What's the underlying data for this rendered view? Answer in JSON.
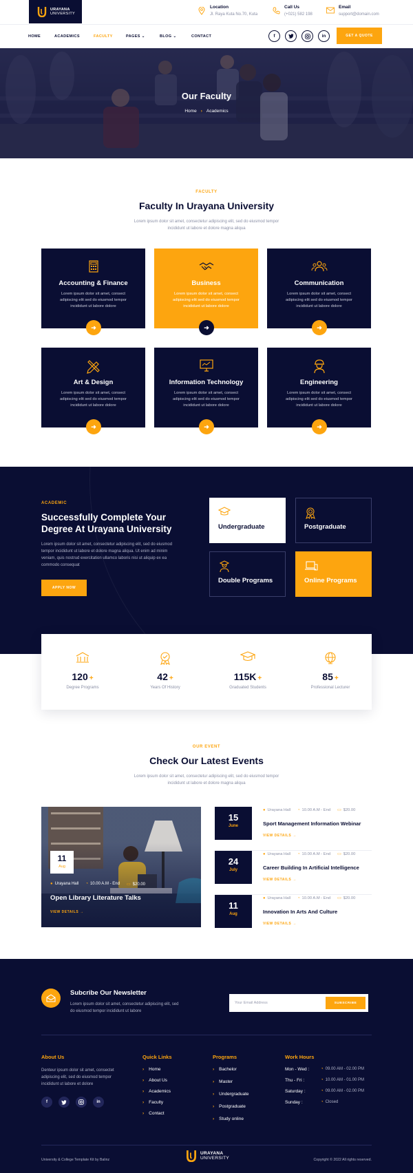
{
  "brand": {
    "name": "URAYANA",
    "subtitle": "UNIVERSITY",
    "accent_color": "#fda50f",
    "navy_color": "#0a0e33"
  },
  "topbar": {
    "location": {
      "label": "Location",
      "value": "Jl. Raya Kuta No.70, Kuta",
      "icon": "map-pin-icon"
    },
    "call": {
      "label": "Call Us",
      "value": "(+021) 582 198",
      "icon": "phone-icon"
    },
    "email": {
      "label": "Email",
      "value": "support@domain.com",
      "icon": "mail-icon"
    }
  },
  "nav": {
    "items": [
      {
        "label": "HOME",
        "active": false
      },
      {
        "label": "ACADEMICS",
        "active": false
      },
      {
        "label": "FACULTY",
        "active": true
      },
      {
        "label": "PAGES",
        "dropdown": true
      },
      {
        "label": "BLOG",
        "dropdown": true
      },
      {
        "label": "CONTACT",
        "active": false
      }
    ],
    "social": [
      "f",
      "t",
      "ig",
      "in"
    ],
    "cta": "GET A QUOTE"
  },
  "hero": {
    "title": "Our Faculty",
    "breadcrumb": [
      "Home",
      "Academics"
    ]
  },
  "faculty": {
    "eyebrow": "FACULTY",
    "title": "Faculty In Urayana University",
    "desc": "Lorem ipsum dolor sit amet, consectetur adipiscing elit, sed do eiusmod tempor incididunt ut labore et dolore magna aliqua",
    "cards": [
      {
        "title": "Accounting & Finance",
        "desc": "Lorem ipsum dolor sit amet, consect adipiscing elit sed do eiusmod tempor incididunt ut labore dolore",
        "icon": "calculator-icon"
      },
      {
        "title": "Business",
        "desc": "Lorem ipsum dolor sit amet, consect adipiscing elit sed do eiusmod tempor incididunt ut labore dolore",
        "icon": "handshake-icon"
      },
      {
        "title": "Communication",
        "desc": "Lorem ipsum dolor sit amet, consect adipiscing elit sed do eiusmod tempor incididunt ut labore dolore",
        "icon": "people-icon"
      },
      {
        "title": "Art & Design",
        "desc": "Lorem ipsum dolor sit amet, consect adipiscing elit sed do eiusmod tempor incididunt ut labore dolore",
        "icon": "pencil-ruler-icon"
      },
      {
        "title": "Information Technology",
        "desc": "Lorem ipsum dolor sit amet, consect adipiscing elit sed do eiusmod tempor incididunt ut labore dolore",
        "icon": "monitor-icon"
      },
      {
        "title": "Engineering",
        "desc": "Lorem ipsum dolor sit amet, consect adipiscing elit sed do eiusmod tempor incididunt ut labore dolore",
        "icon": "engineer-icon"
      }
    ]
  },
  "academic": {
    "eyebrow": "ACADEMIC",
    "title": "Successfully Complete Your Degree At Urayana University",
    "desc": "Lorem ipsum dolor sit amet, consectetur adipiscing elit, sed do eiusmod tempor incididunt ut labore et dolore magna aliqua. Ut enim ad minim veniam, quis nostrud exercitation ullamco laboris nisi ut aliquip ex ea commodo consequat",
    "cta": "APPLY NOW",
    "programs": [
      {
        "title": "Undergraduate",
        "icon": "graduation-cap-icon"
      },
      {
        "title": "Postgraduate",
        "icon": "medal-icon"
      },
      {
        "title": "Double Programs",
        "icon": "graduate-person-icon"
      },
      {
        "title": "Online Programs",
        "icon": "laptop-icon"
      }
    ]
  },
  "stats": [
    {
      "value": "120",
      "label": "Degree Programs",
      "icon": "building-icon"
    },
    {
      "value": "42",
      "label": "Years Of History",
      "icon": "award-icon"
    },
    {
      "value": "115K",
      "label": "Graduated Students",
      "icon": "mortarboard-icon"
    },
    {
      "value": "85",
      "label": "Professional Lecturer",
      "icon": "globe-icon"
    }
  ],
  "events": {
    "eyebrow": "OUR EVENT",
    "title": "Check Our Latest Events",
    "desc": "Lorem ipsum dolor sit amet, consectetur adipiscing elit, sed do eiusmod tempor incididunt ut labore et dolore magna aliqua",
    "featured": {
      "day": "11",
      "month": "Aug",
      "location": "Urayana Hall",
      "time": "10.00 A.M - End",
      "price": "$20.00",
      "title": "Open Library Literature Talks",
      "link": "VIEW DETAILS"
    },
    "list": [
      {
        "day": "15",
        "month": "June",
        "location": "Urayana Hall",
        "time": "10.00 A.M - End",
        "price": "$20.00",
        "title": "Sport Management Information Webinar",
        "link": "VIEW DETAILS"
      },
      {
        "day": "24",
        "month": "July",
        "location": "Urayana Hall",
        "time": "10.00 A.M - End",
        "price": "$20.00",
        "title": "Career Building In Artificial Intelligence",
        "link": "VIEW DETAILS"
      },
      {
        "day": "11",
        "month": "Aug",
        "location": "Urayana Hall",
        "time": "10.00 A.M - End",
        "price": "$20.00",
        "title": "Innovation In Arts And Culture",
        "link": "VIEW DETAILS"
      }
    ]
  },
  "footer": {
    "newsletter": {
      "title": "Subcribe Our Newsletter",
      "desc": "Lorem ipsum dolor sit amet, consectetur adipiscing elit, sed do eiusmod tempor incididunt ut labore",
      "placeholder": "Your Email Address",
      "button": "SUBSCRIBE"
    },
    "about": {
      "title": "About Us",
      "text": "Denteur ipsum dolor sit amet, consectet adipiscing elit, sed do eiusmod tempor incididunt ut labore et dolore"
    },
    "quick_links": {
      "title": "Quick Links",
      "items": [
        "Home",
        "About Us",
        "Academics",
        "Faculty",
        "Contact"
      ]
    },
    "programs": {
      "title": "Programs",
      "items": [
        "Bachelor",
        "Master",
        "Undergraduate",
        "Postgraduate",
        "Study online"
      ]
    },
    "hours": {
      "title": "Work Hours",
      "rows": [
        {
          "day": "Mon - Wed :",
          "time": "09.00 AM - 02.00 PM"
        },
        {
          "day": "Thu - Fri :",
          "time": "10.00 AM - 01.00 PM"
        },
        {
          "day": "Saturday :",
          "time": "09.00 AM - 02.00 PM"
        },
        {
          "day": "Sunday :",
          "time": "Closed"
        }
      ]
    },
    "credit": "University & College Template Kit by Balinz",
    "copyright": "Copyright © 2022 All rights reserved."
  }
}
